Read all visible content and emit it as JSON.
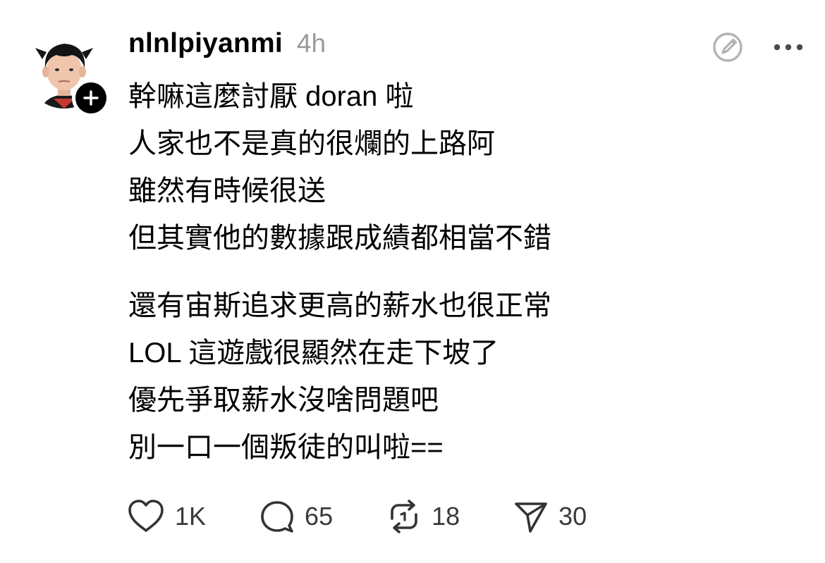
{
  "post": {
    "username": "nlnlpiyanmi",
    "timestamp": "4h",
    "lines": [
      "幹嘛這麼討厭 doran 啦",
      "人家也不是真的很爛的上路阿",
      "雖然有時候很送",
      "但其實他的數據跟成績都相當不錯",
      "還有宙斯追求更高的薪水也很正常",
      "LOL 這遊戲很顯然在走下坡了",
      "優先爭取薪水沒啥問題吧",
      "別一口一個叛徒的叫啦=="
    ]
  },
  "actions": {
    "likes": "1K",
    "comments": "65",
    "reposts": "18",
    "shares": "30"
  },
  "icons": {
    "follow": "plus-icon",
    "edit": "edit-icon",
    "more": "more-icon",
    "like": "heart-icon",
    "comment": "comment-icon",
    "repost": "repost-icon",
    "share": "send-icon"
  }
}
